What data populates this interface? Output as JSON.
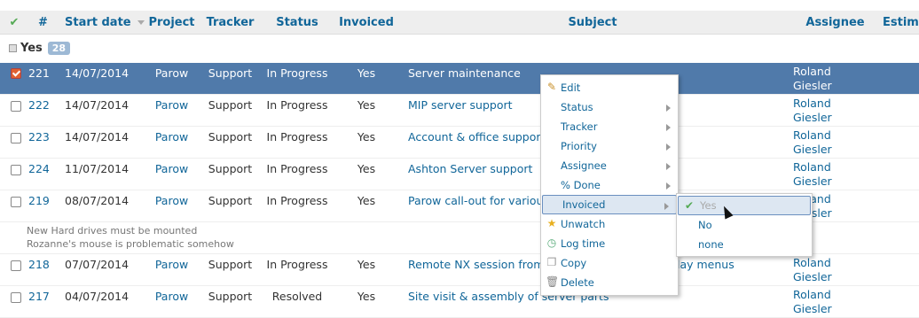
{
  "header": {
    "check_mark": "✔",
    "id": "#",
    "start_date": "Start date",
    "project": "Project",
    "tracker": "Tracker",
    "status": "Status",
    "invoiced": "Invoiced",
    "subject": "Subject",
    "assignee": "Assignee",
    "estimated": "Estim"
  },
  "group": {
    "label": "Yes",
    "count": "28"
  },
  "issues": [
    {
      "id": "221",
      "date": "14/07/2014",
      "project": "Parow",
      "tracker": "Support",
      "status": "In Progress",
      "invoiced": "Yes",
      "subject": "Server maintenance",
      "assignee1": "Roland",
      "assignee2": "Giesler"
    },
    {
      "id": "222",
      "date": "14/07/2014",
      "project": "Parow",
      "tracker": "Support",
      "status": "In Progress",
      "invoiced": "Yes",
      "subject": "MIP server support",
      "assignee1": "Roland",
      "assignee2": "Giesler"
    },
    {
      "id": "223",
      "date": "14/07/2014",
      "project": "Parow",
      "tracker": "Support",
      "status": "In Progress",
      "invoiced": "Yes",
      "subject": "Account & office support",
      "assignee1": "Roland",
      "assignee2": "Giesler"
    },
    {
      "id": "224",
      "date": "11/07/2014",
      "project": "Parow",
      "tracker": "Support",
      "status": "In Progress",
      "invoiced": "Yes",
      "subject": "Ashton Server support",
      "assignee1": "Roland",
      "assignee2": "Giesler"
    },
    {
      "id": "219",
      "date": "08/07/2014",
      "project": "Parow",
      "tracker": "Support",
      "status": "In Progress",
      "invoiced": "Yes",
      "subject": "Parow call-out for various",
      "assignee1": "Roland",
      "assignee2": "Giesler",
      "desc1": "New Hard drives must be mounted",
      "desc2": "Rozanne's mouse is problematic somehow"
    },
    {
      "id": "218",
      "date": "07/07/2014",
      "project": "Parow",
      "tracker": "Support",
      "status": "In Progress",
      "invoiced": "Yes",
      "subject": "Remote NX session from A",
      "subject_tail": "lay menus",
      "assignee1": "Roland",
      "assignee2": "Giesler"
    },
    {
      "id": "217",
      "date": "04/07/2014",
      "project": "Parow",
      "tracker": "Support",
      "status": "Resolved",
      "invoiced": "Yes",
      "subject": "Site visit & assembly of server parts",
      "assignee1": "Roland",
      "assignee2": "Giesler"
    }
  ],
  "context_menu": {
    "edit": "Edit",
    "status": "Status",
    "tracker": "Tracker",
    "priority": "Priority",
    "assignee": "Assignee",
    "done": "% Done",
    "invoiced": "Invoiced",
    "unwatch": "Unwatch",
    "log_time": "Log time",
    "copy": "Copy",
    "delete": "Delete"
  },
  "submenu": {
    "yes": "Yes",
    "no": "No",
    "none": "none"
  },
  "colors": {
    "selected_row": "#507aaa",
    "link": "#1166aa",
    "header_bg": "#eeeeee"
  }
}
